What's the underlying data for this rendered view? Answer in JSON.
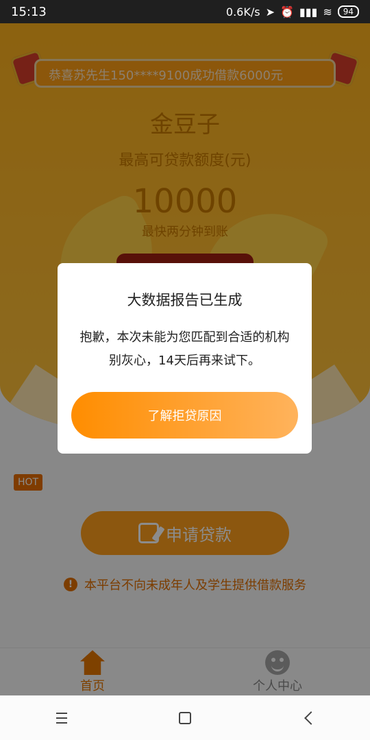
{
  "status_bar": {
    "time": "15:13",
    "network": "0.6K/s",
    "battery": "94"
  },
  "hero": {
    "marquee_text": "恭喜苏先生150****9100成功借款6000元",
    "title": "金豆子",
    "subtitle": "最高可贷款额度(元)",
    "amount": "10000",
    "speed": "最快两分钟到账"
  },
  "badge": {
    "hot": "HOT"
  },
  "apply": {
    "label": "申请贷款"
  },
  "notice": {
    "text": "本平台不向未成年人及学生提供借款服务"
  },
  "tabs": [
    {
      "label": "首页"
    },
    {
      "label": "个人中心"
    }
  ],
  "dialog": {
    "title": "大数据报告已生成",
    "message_line1": "抱歉，本次未能为您匹配到合适的机构",
    "message_line2": "别灰心，14天后再来试下。",
    "button": "了解拒贷原因"
  },
  "colors": {
    "primary": "#ff9f1c",
    "accent": "#e67700"
  },
  "icons": [
    "edit-icon",
    "warning-icon",
    "home-icon",
    "user-icon",
    "menu-icon",
    "square-icon",
    "back-icon"
  ]
}
